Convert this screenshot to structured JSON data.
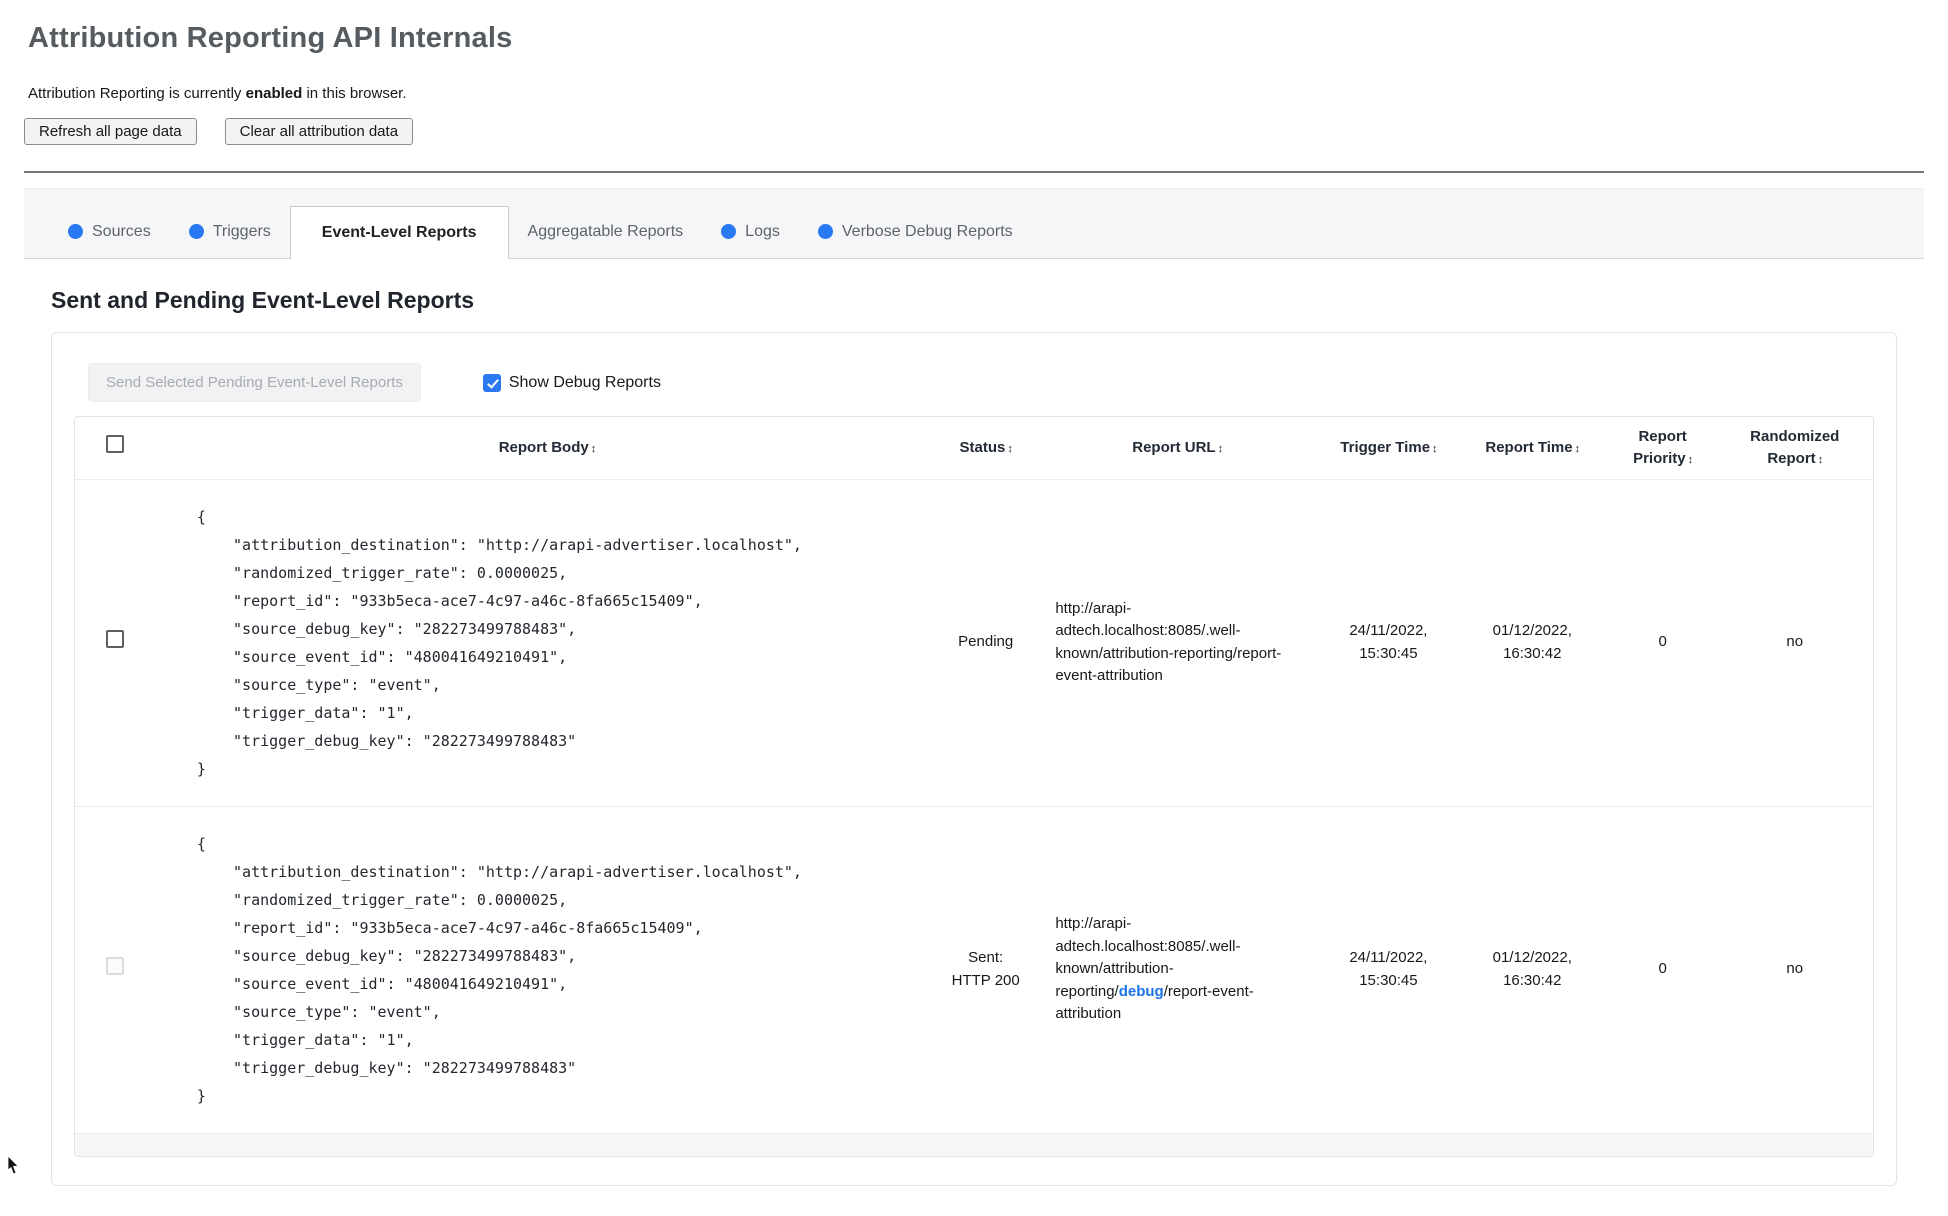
{
  "colors": {
    "accent_blue": "#2979f2",
    "link_blue": "#1a73e8"
  },
  "page": {
    "title": "Attribution Reporting API Internals",
    "status_prefix": "Attribution Reporting is currently ",
    "status_bold": "enabled",
    "status_suffix": " in this browser.",
    "refresh_button": "Refresh all page data",
    "clear_button": "Clear all attribution data"
  },
  "tabs": [
    {
      "label": "Sources"
    },
    {
      "label": "Triggers"
    },
    {
      "label": "Event-Level Reports"
    },
    {
      "label": "Aggregatable Reports"
    },
    {
      "label": "Logs"
    },
    {
      "label": "Verbose Debug Reports"
    }
  ],
  "section": {
    "heading": "Sent and Pending Event-Level Reports",
    "send_button": "Send Selected Pending Event-Level Reports",
    "show_debug_label": "Show Debug Reports"
  },
  "table": {
    "sort_icon": "↕",
    "headers": {
      "body": "Report Body",
      "status": "Status",
      "url": "Report URL",
      "trigger_time": "Trigger Time",
      "report_time": "Report Time",
      "priority": "Report Priority",
      "randomized": "Randomized Report"
    },
    "rows": [
      {
        "body": "{\n    \"attribution_destination\": \"http://arapi-advertiser.localhost\",\n    \"randomized_trigger_rate\": 0.0000025,\n    \"report_id\": \"933b5eca-ace7-4c97-a46c-8fa665c15409\",\n    \"source_debug_key\": \"282273499788483\",\n    \"source_event_id\": \"480041649210491\",\n    \"source_type\": \"event\",\n    \"trigger_data\": \"1\",\n    \"trigger_debug_key\": \"282273499788483\"\n}",
        "status": "Pending",
        "url": "http://arapi-adtech.localhost:8085/.well-known/attribution-reporting/report-event-attribution",
        "trigger_time": "24/11/2022, 15:30:45",
        "report_time": "01/12/2022, 16:30:42",
        "priority": "0",
        "randomized": "no"
      },
      {
        "body": "{\n    \"attribution_destination\": \"http://arapi-advertiser.localhost\",\n    \"randomized_trigger_rate\": 0.0000025,\n    \"report_id\": \"933b5eca-ace7-4c97-a46c-8fa665c15409\",\n    \"source_debug_key\": \"282273499788483\",\n    \"source_event_id\": \"480041649210491\",\n    \"source_type\": \"event\",\n    \"trigger_data\": \"1\",\n    \"trigger_debug_key\": \"282273499788483\"\n}",
        "status": "Sent: HTTP 200",
        "url_prefix": "http://arapi-adtech.localhost:8085/.well-known/attribution-reporting/",
        "url_debug": "debug",
        "url_suffix": "/report-event-attribution",
        "trigger_time": "24/11/2022, 15:30:45",
        "report_time": "01/12/2022, 16:30:42",
        "priority": "0",
        "randomized": "no"
      }
    ]
  }
}
